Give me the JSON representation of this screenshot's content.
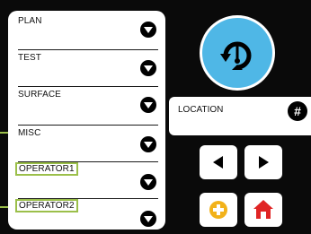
{
  "menu": {
    "items": [
      {
        "label": "PLAN"
      },
      {
        "label": "TEST"
      },
      {
        "label": "SURFACE"
      },
      {
        "label": "MISC"
      },
      {
        "label": "OPERATOR1"
      },
      {
        "label": "OPERATOR2"
      }
    ]
  },
  "location": {
    "label": "LOCATION",
    "hash_symbol": "#"
  },
  "colors": {
    "highlight": "#9bbf4a",
    "scan_button": "#4fb7e6",
    "add_button": "#f2b21a",
    "home_button": "#e02424"
  },
  "icons": {
    "scan": "rotate-scan-icon",
    "left": "arrow-left-icon",
    "right": "arrow-right-icon",
    "add": "plus-circle-icon",
    "home": "home-icon"
  }
}
